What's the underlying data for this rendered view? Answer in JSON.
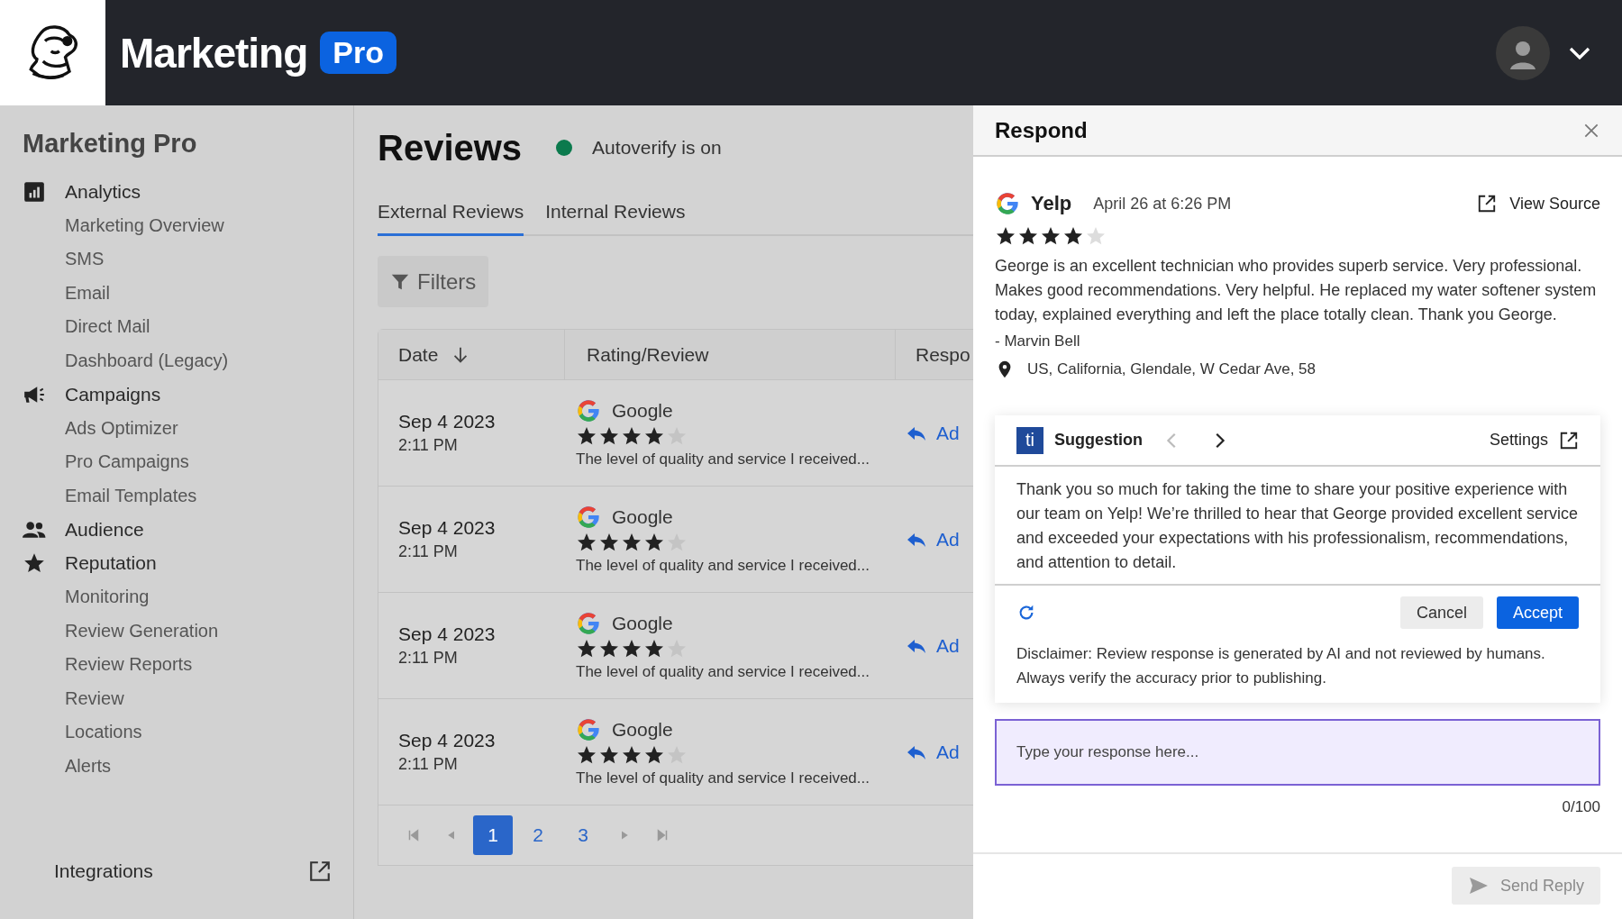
{
  "header": {
    "brand": "Marketing",
    "badge": "Pro"
  },
  "sidebar": {
    "title": "Marketing Pro",
    "sections": [
      {
        "label": "Analytics",
        "children": [
          {
            "label": "Marketing Overview"
          },
          {
            "label": "SMS"
          },
          {
            "label": "Email"
          },
          {
            "label": "Direct Mail"
          },
          {
            "label": "Dashboard (Legacy)"
          }
        ]
      },
      {
        "label": "Campaigns",
        "children": [
          {
            "label": "Ads Optimizer"
          },
          {
            "label": "Pro Campaigns"
          },
          {
            "label": "Email Templates"
          }
        ]
      },
      {
        "label": "Audience"
      },
      {
        "label": "Reputation",
        "children": [
          {
            "label": "Monitoring"
          },
          {
            "label": "Review Generation"
          },
          {
            "label": "Review Reports"
          },
          {
            "label": "Review"
          },
          {
            "label": "Locations"
          },
          {
            "label": "Alerts"
          }
        ]
      }
    ],
    "footer": "Integrations"
  },
  "main": {
    "title": "Reviews",
    "status": {
      "text": "Autoverify is on",
      "on": true
    },
    "tabs": [
      {
        "label": "External Reviews",
        "selected": true
      },
      {
        "label": "Internal Reviews",
        "selected": false
      }
    ],
    "filters": "Filters",
    "table": {
      "columns": [
        "Date",
        "Rating/Review",
        "Respo"
      ],
      "rows": [
        {
          "date": "Sep 4 2023",
          "time": "2:11 PM",
          "source": "Google",
          "stars": 4,
          "excerpt": "The level of quality and service I received...",
          "action": "Ad"
        },
        {
          "date": "Sep 4 2023",
          "time": "2:11 PM",
          "source": "Google",
          "stars": 4,
          "excerpt": "The level of quality and service I received...",
          "action": "Ad"
        },
        {
          "date": "Sep 4 2023",
          "time": "2:11 PM",
          "source": "Google",
          "stars": 4,
          "excerpt": "The level of quality and service I received...",
          "action": "Ad"
        },
        {
          "date": "Sep 4 2023",
          "time": "2:11 PM",
          "source": "Google",
          "stars": 4,
          "excerpt": "The level of quality and service I received...",
          "action": "Ad"
        }
      ]
    },
    "pagination": [
      {
        "label": "1",
        "selected": true
      },
      {
        "label": "2",
        "selected": false
      },
      {
        "label": "3",
        "selected": false
      }
    ]
  },
  "panel": {
    "title": "Respond",
    "review": {
      "source": "Yelp",
      "date": "April 26 at 6:26 PM",
      "view_source": "View Source",
      "stars": 4,
      "body": "George is an excellent technician who provides superb service. Very professional. Makes good recommendations. Very helpful. He replaced my water softener system today, explained everything and left the place totally clean. Thank you George.",
      "author": "- Marvin Bell",
      "location": "US, California, Glendale, W Cedar Ave, 58"
    },
    "suggestion": {
      "logo": "ti",
      "label": "Suggestion",
      "prev_disabled": true,
      "next_disabled": false,
      "settings": "Settings",
      "text": "Thank you so much for taking the time to share your positive experience with our team on Yelp! We’re thrilled to hear that George provided excellent service and exceeded your expectations with his professionalism, recommendations, and attention to detail.",
      "cancel": "Cancel",
      "accept": "Accept",
      "disclaimer": "Disclaimer: Review response is generated by AI and not reviewed by humans. Always verify the accuracy prior to publishing."
    },
    "response": {
      "placeholder": "Type your response here...",
      "counter": "0/100"
    },
    "send": {
      "label": "Send Reply",
      "disabled": true
    }
  }
}
